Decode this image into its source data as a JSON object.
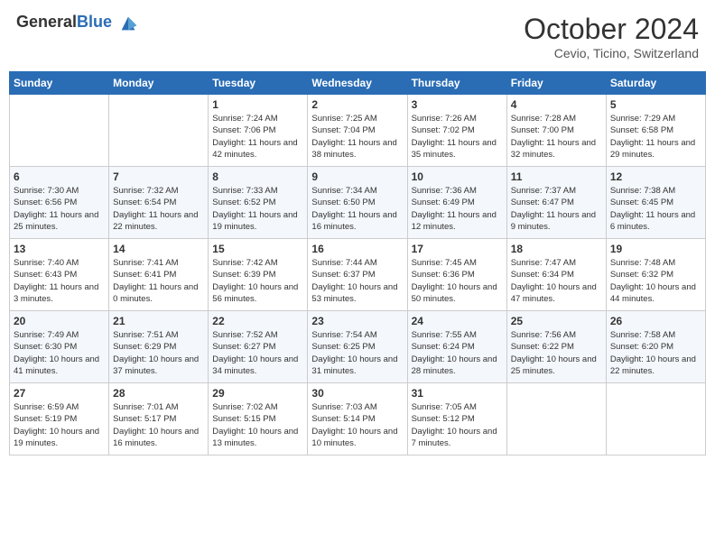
{
  "header": {
    "logo_general": "General",
    "logo_blue": "Blue",
    "month": "October 2024",
    "location": "Cevio, Ticino, Switzerland"
  },
  "weekdays": [
    "Sunday",
    "Monday",
    "Tuesday",
    "Wednesday",
    "Thursday",
    "Friday",
    "Saturday"
  ],
  "weeks": [
    [
      {
        "day": "",
        "sunrise": "",
        "sunset": "",
        "daylight": ""
      },
      {
        "day": "",
        "sunrise": "",
        "sunset": "",
        "daylight": ""
      },
      {
        "day": "1",
        "sunrise": "Sunrise: 7:24 AM",
        "sunset": "Sunset: 7:06 PM",
        "daylight": "Daylight: 11 hours and 42 minutes."
      },
      {
        "day": "2",
        "sunrise": "Sunrise: 7:25 AM",
        "sunset": "Sunset: 7:04 PM",
        "daylight": "Daylight: 11 hours and 38 minutes."
      },
      {
        "day": "3",
        "sunrise": "Sunrise: 7:26 AM",
        "sunset": "Sunset: 7:02 PM",
        "daylight": "Daylight: 11 hours and 35 minutes."
      },
      {
        "day": "4",
        "sunrise": "Sunrise: 7:28 AM",
        "sunset": "Sunset: 7:00 PM",
        "daylight": "Daylight: 11 hours and 32 minutes."
      },
      {
        "day": "5",
        "sunrise": "Sunrise: 7:29 AM",
        "sunset": "Sunset: 6:58 PM",
        "daylight": "Daylight: 11 hours and 29 minutes."
      }
    ],
    [
      {
        "day": "6",
        "sunrise": "Sunrise: 7:30 AM",
        "sunset": "Sunset: 6:56 PM",
        "daylight": "Daylight: 11 hours and 25 minutes."
      },
      {
        "day": "7",
        "sunrise": "Sunrise: 7:32 AM",
        "sunset": "Sunset: 6:54 PM",
        "daylight": "Daylight: 11 hours and 22 minutes."
      },
      {
        "day": "8",
        "sunrise": "Sunrise: 7:33 AM",
        "sunset": "Sunset: 6:52 PM",
        "daylight": "Daylight: 11 hours and 19 minutes."
      },
      {
        "day": "9",
        "sunrise": "Sunrise: 7:34 AM",
        "sunset": "Sunset: 6:50 PM",
        "daylight": "Daylight: 11 hours and 16 minutes."
      },
      {
        "day": "10",
        "sunrise": "Sunrise: 7:36 AM",
        "sunset": "Sunset: 6:49 PM",
        "daylight": "Daylight: 11 hours and 12 minutes."
      },
      {
        "day": "11",
        "sunrise": "Sunrise: 7:37 AM",
        "sunset": "Sunset: 6:47 PM",
        "daylight": "Daylight: 11 hours and 9 minutes."
      },
      {
        "day": "12",
        "sunrise": "Sunrise: 7:38 AM",
        "sunset": "Sunset: 6:45 PM",
        "daylight": "Daylight: 11 hours and 6 minutes."
      }
    ],
    [
      {
        "day": "13",
        "sunrise": "Sunrise: 7:40 AM",
        "sunset": "Sunset: 6:43 PM",
        "daylight": "Daylight: 11 hours and 3 minutes."
      },
      {
        "day": "14",
        "sunrise": "Sunrise: 7:41 AM",
        "sunset": "Sunset: 6:41 PM",
        "daylight": "Daylight: 11 hours and 0 minutes."
      },
      {
        "day": "15",
        "sunrise": "Sunrise: 7:42 AM",
        "sunset": "Sunset: 6:39 PM",
        "daylight": "Daylight: 10 hours and 56 minutes."
      },
      {
        "day": "16",
        "sunrise": "Sunrise: 7:44 AM",
        "sunset": "Sunset: 6:37 PM",
        "daylight": "Daylight: 10 hours and 53 minutes."
      },
      {
        "day": "17",
        "sunrise": "Sunrise: 7:45 AM",
        "sunset": "Sunset: 6:36 PM",
        "daylight": "Daylight: 10 hours and 50 minutes."
      },
      {
        "day": "18",
        "sunrise": "Sunrise: 7:47 AM",
        "sunset": "Sunset: 6:34 PM",
        "daylight": "Daylight: 10 hours and 47 minutes."
      },
      {
        "day": "19",
        "sunrise": "Sunrise: 7:48 AM",
        "sunset": "Sunset: 6:32 PM",
        "daylight": "Daylight: 10 hours and 44 minutes."
      }
    ],
    [
      {
        "day": "20",
        "sunrise": "Sunrise: 7:49 AM",
        "sunset": "Sunset: 6:30 PM",
        "daylight": "Daylight: 10 hours and 41 minutes."
      },
      {
        "day": "21",
        "sunrise": "Sunrise: 7:51 AM",
        "sunset": "Sunset: 6:29 PM",
        "daylight": "Daylight: 10 hours and 37 minutes."
      },
      {
        "day": "22",
        "sunrise": "Sunrise: 7:52 AM",
        "sunset": "Sunset: 6:27 PM",
        "daylight": "Daylight: 10 hours and 34 minutes."
      },
      {
        "day": "23",
        "sunrise": "Sunrise: 7:54 AM",
        "sunset": "Sunset: 6:25 PM",
        "daylight": "Daylight: 10 hours and 31 minutes."
      },
      {
        "day": "24",
        "sunrise": "Sunrise: 7:55 AM",
        "sunset": "Sunset: 6:24 PM",
        "daylight": "Daylight: 10 hours and 28 minutes."
      },
      {
        "day": "25",
        "sunrise": "Sunrise: 7:56 AM",
        "sunset": "Sunset: 6:22 PM",
        "daylight": "Daylight: 10 hours and 25 minutes."
      },
      {
        "day": "26",
        "sunrise": "Sunrise: 7:58 AM",
        "sunset": "Sunset: 6:20 PM",
        "daylight": "Daylight: 10 hours and 22 minutes."
      }
    ],
    [
      {
        "day": "27",
        "sunrise": "Sunrise: 6:59 AM",
        "sunset": "Sunset: 5:19 PM",
        "daylight": "Daylight: 10 hours and 19 minutes."
      },
      {
        "day": "28",
        "sunrise": "Sunrise: 7:01 AM",
        "sunset": "Sunset: 5:17 PM",
        "daylight": "Daylight: 10 hours and 16 minutes."
      },
      {
        "day": "29",
        "sunrise": "Sunrise: 7:02 AM",
        "sunset": "Sunset: 5:15 PM",
        "daylight": "Daylight: 10 hours and 13 minutes."
      },
      {
        "day": "30",
        "sunrise": "Sunrise: 7:03 AM",
        "sunset": "Sunset: 5:14 PM",
        "daylight": "Daylight: 10 hours and 10 minutes."
      },
      {
        "day": "31",
        "sunrise": "Sunrise: 7:05 AM",
        "sunset": "Sunset: 5:12 PM",
        "daylight": "Daylight: 10 hours and 7 minutes."
      },
      {
        "day": "",
        "sunrise": "",
        "sunset": "",
        "daylight": ""
      },
      {
        "day": "",
        "sunrise": "",
        "sunset": "",
        "daylight": ""
      }
    ]
  ]
}
